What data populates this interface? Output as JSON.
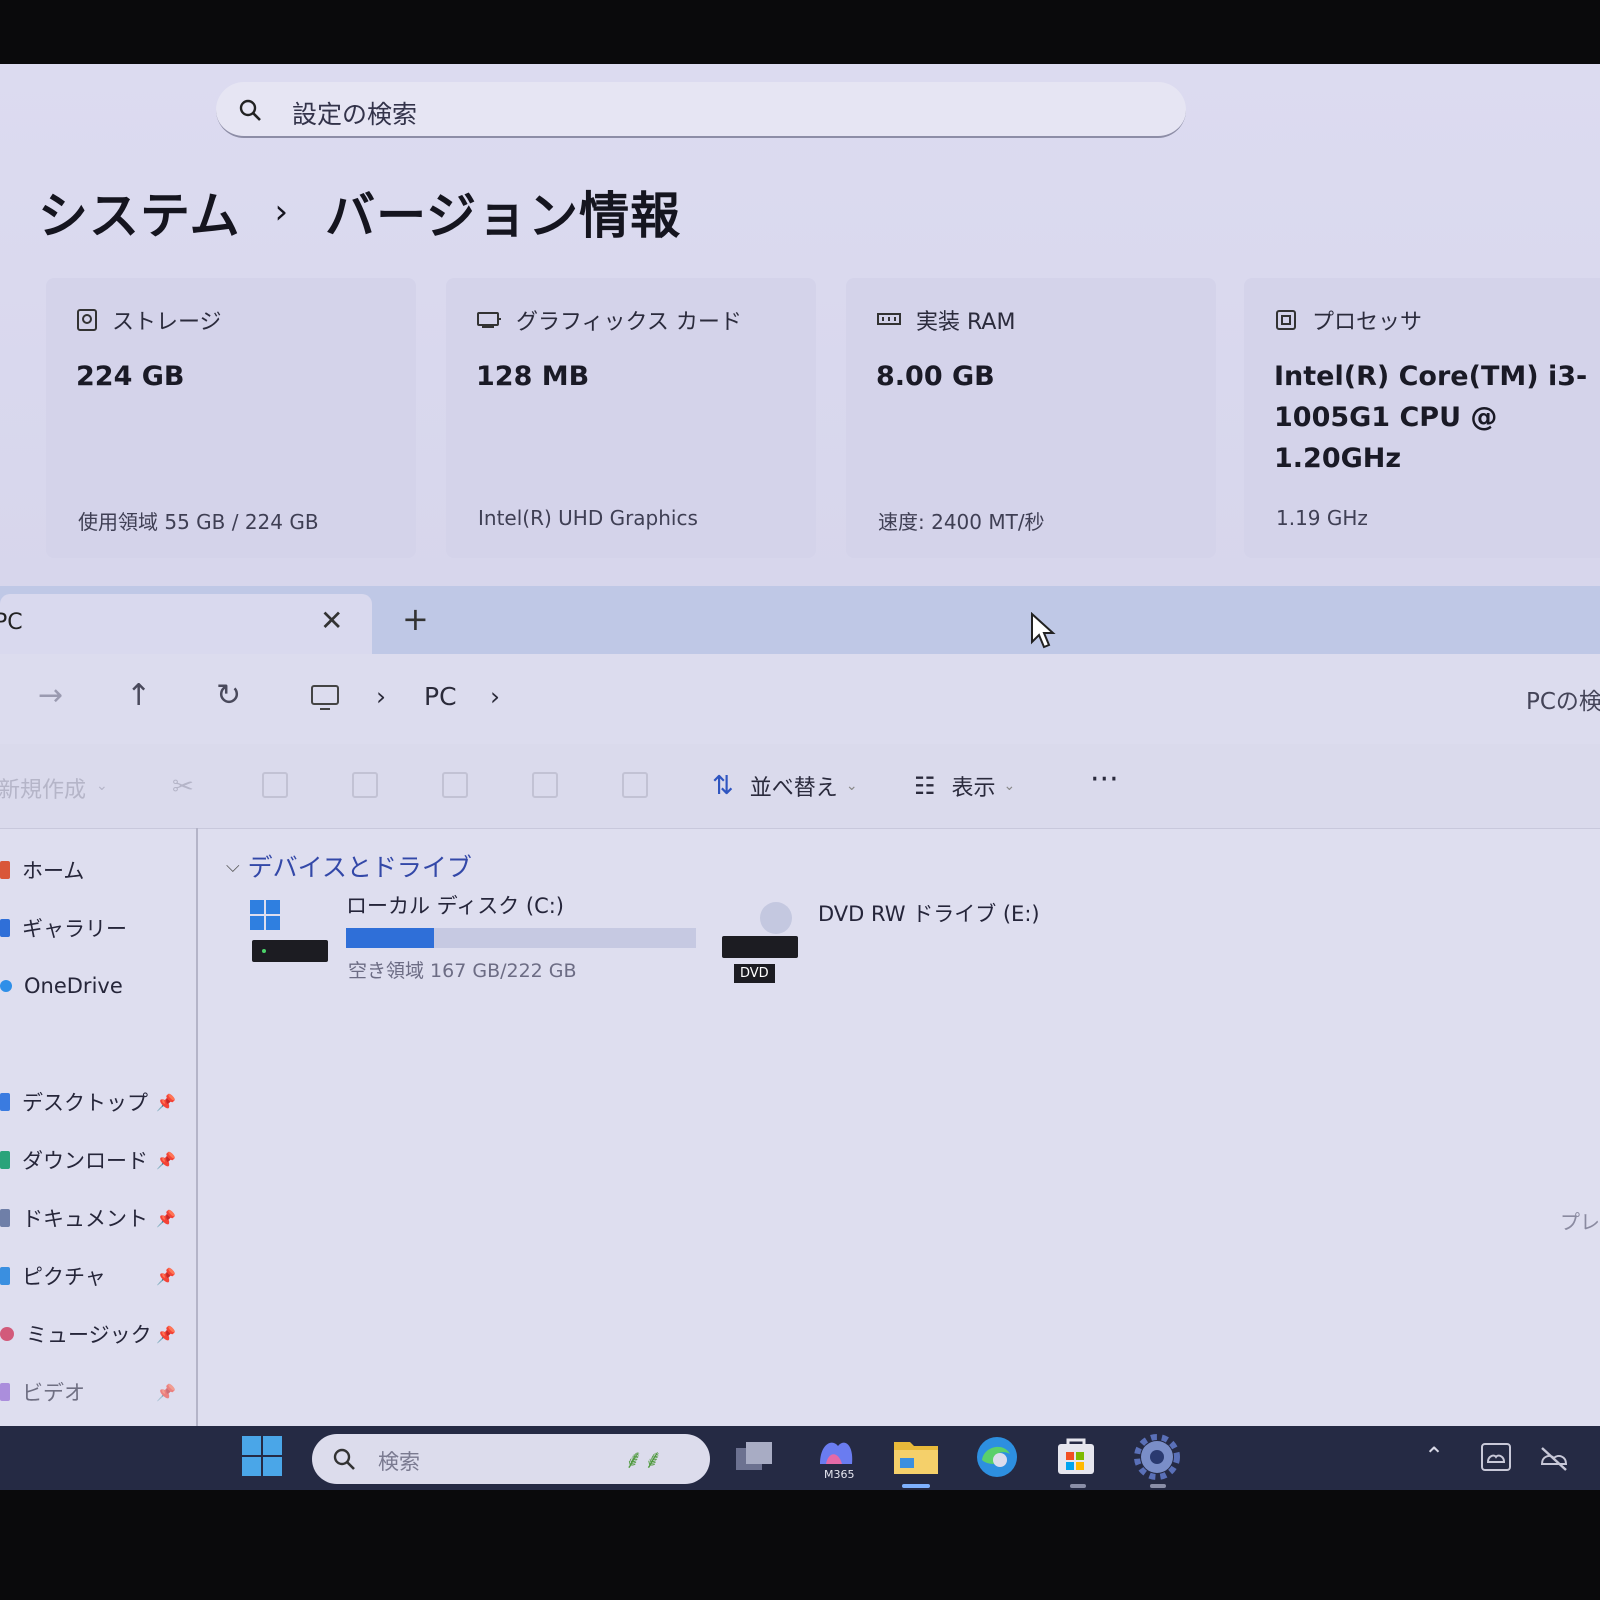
{
  "settings": {
    "search_placeholder": "設定の検索",
    "breadcrumb": [
      "システム",
      "バージョン情報"
    ],
    "specs": [
      {
        "label": "ストレージ",
        "value": "224 GB",
        "sub": "使用領域 55 GB / 224 GB",
        "icon": "storage-icon"
      },
      {
        "label": "グラフィックス カード",
        "value": "128 MB",
        "sub": "Intel(R) UHD Graphics",
        "icon": "gpu-icon"
      },
      {
        "label": "実装 RAM",
        "value": "8.00 GB",
        "sub": "速度: 2400 MT/秒",
        "icon": "ram-icon"
      },
      {
        "label": "プロセッサ",
        "value": "Intel(R) Core(TM) i3-1005G1 CPU @ 1.20GHz",
        "sub": "1.19 GHz",
        "icon": "processor-icon"
      }
    ]
  },
  "explorer": {
    "tab_title": "PC",
    "address": {
      "crumbs": [
        "PC"
      ],
      "search_placeholder": "PCの検索"
    },
    "toolbar": {
      "new_label": "新規作成",
      "sort_label": "並べ替え",
      "view_label": "表示",
      "more_label": "···"
    },
    "nav_items": [
      {
        "label": "ホーム",
        "color": "#d9573a",
        "pinned": false
      },
      {
        "label": "ギャラリー",
        "color": "#2f6fd8",
        "pinned": false
      },
      {
        "label": "OneDrive",
        "color": "#2f8fe8",
        "pinned": false
      },
      {
        "label": "デスクトップ",
        "color": "#3a7be0",
        "pinned": true
      },
      {
        "label": "ダウンロード",
        "color": "#2aa37a",
        "pinned": true
      },
      {
        "label": "ドキュメント",
        "color": "#6f7fa8",
        "pinned": true
      },
      {
        "label": "ピクチャ",
        "color": "#3a8fe0",
        "pinned": true
      },
      {
        "label": "ミュージック",
        "color": "#d25a7a",
        "pinned": true
      },
      {
        "label": "ビデオ",
        "color": "#8a5ad0",
        "pinned": true
      }
    ],
    "group_title": "デバイスとドライブ",
    "drives": [
      {
        "name": "ローカル ディスク (C:)",
        "free_text": "空き領域 167 GB/222 GB",
        "used_fraction": 0.25
      },
      {
        "name": "DVD RW ドライブ (E:)",
        "badge": "DVD"
      }
    ],
    "preview_label": "プレビ"
  },
  "taskbar": {
    "search_placeholder": "検索",
    "m365_label": "M365",
    "apps": [
      "start-icon",
      "task-view-icon",
      "m365-copilot-icon",
      "file-explorer-icon",
      "edge-icon",
      "store-icon",
      "settings-gear-icon"
    ],
    "tray": [
      "chevron-up-icon",
      "onedrive-sync-icon",
      "network-off-icon"
    ],
    "accent": "#7eb1ff"
  }
}
